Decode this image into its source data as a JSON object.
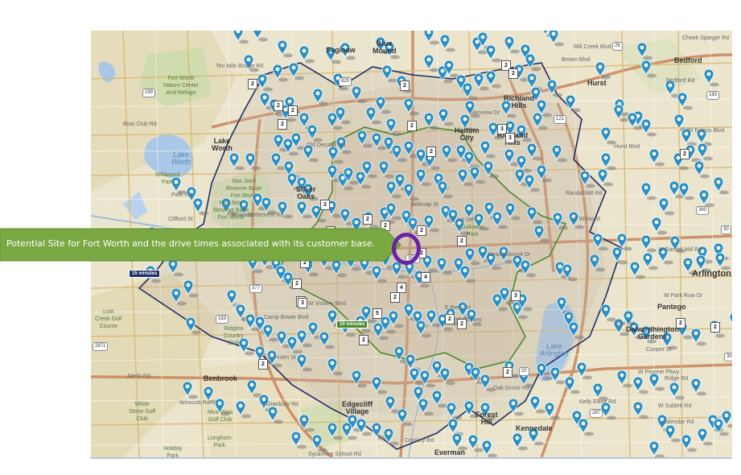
{
  "callout": {
    "text": "Potential Site for Fort Worth and the drive times associated with its customer base."
  },
  "colors": {
    "callout_fill": "#7aa843",
    "site_marker": "#6a22a7",
    "customer_pin": "#2a8fc4",
    "drive_time_15": "#1d2f66",
    "drive_time_10": "#4c8a2f"
  },
  "drive_times": {
    "outer_label": "15 minutes",
    "inner_label": "10 minutes"
  },
  "map": {
    "places": [
      {
        "name": "Saginaw",
        "cls": "city"
      },
      {
        "name": "Blue\nMound",
        "cls": "city"
      },
      {
        "name": "Fort Worth\nNature Center\nAnd Refuge",
        "cls": "green"
      },
      {
        "name": "Lake\nWorth",
        "cls": "city"
      },
      {
        "name": "Lake\nWorth",
        "cls": "water"
      },
      {
        "name": "Haltom\nCity",
        "cls": "city"
      },
      {
        "name": "Richland\nHills",
        "cls": "city"
      },
      {
        "name": "Richland\nHills",
        "cls": "city"
      },
      {
        "name": "Hurst",
        "cls": "city"
      },
      {
        "name": "Bedford",
        "cls": "city"
      },
      {
        "name": "Arlington",
        "cls": "big"
      },
      {
        "name": "Pantego",
        "cls": "city"
      },
      {
        "name": "Dalworthington\nGardens",
        "cls": "city"
      },
      {
        "name": "Lake\nArlington",
        "cls": "water"
      },
      {
        "name": "Benbrook",
        "cls": "city"
      },
      {
        "name": "Edgecliff\nVillage",
        "cls": "city"
      },
      {
        "name": "Forest\nHill",
        "cls": "city"
      },
      {
        "name": "Kennedale",
        "cls": "city"
      },
      {
        "name": "Everman",
        "cls": "city"
      },
      {
        "name": "Nas Joint\nReserve Base\nFort Worth",
        "cls": "green"
      },
      {
        "name": "Nas Joint\nReserve Base\nFort Worth",
        "cls": "green"
      },
      {
        "name": "Silver\nOaks",
        "cls": "city"
      },
      {
        "name": "Lost\nCreek Golf\nCourse",
        "cls": "green"
      },
      {
        "name": "Ridglea\nCountry\nClub",
        "cls": "green"
      },
      {
        "name": "Mira Vista\nGolf Club",
        "cls": "green"
      },
      {
        "name": "White\nStone Golf\nClub",
        "cls": "green"
      },
      {
        "name": "Longhorn\nPark",
        "cls": "green"
      },
      {
        "name": "Holiday\nPark",
        "cls": "green"
      },
      {
        "name": "Wildwood\nPark",
        "cls": "green"
      },
      {
        "name": "Galloway\nPark",
        "cls": "green"
      },
      {
        "name": "Meadowbrook Dr",
        "cls": "road"
      },
      {
        "name": "E 1st St",
        "cls": "road"
      },
      {
        "name": "Belknap St",
        "cls": "road"
      },
      {
        "name": "E Berry St",
        "cls": "road"
      },
      {
        "name": "W Randol Mill Rd",
        "cls": "road"
      },
      {
        "name": "W Park Row Dr",
        "cls": "road"
      },
      {
        "name": "Aledo Rd",
        "cls": "road"
      },
      {
        "name": "Winscott Rd",
        "cls": "road"
      },
      {
        "name": "Old Decatur Rd",
        "cls": "road"
      },
      {
        "name": "Glenview Dr",
        "cls": "road"
      },
      {
        "name": "Hurst Blvd",
        "cls": "road"
      },
      {
        "name": "Randol Mill Rd",
        "cls": "road"
      },
      {
        "name": "W Pioneer Pkwy",
        "cls": "road"
      },
      {
        "name": "W Sublett Rd",
        "cls": "road"
      },
      {
        "name": "Mansfield Hwy",
        "cls": "road"
      },
      {
        "name": "Oak Grove Rd",
        "cls": "road"
      },
      {
        "name": "Ten Mile Bridge Rd",
        "cls": "road"
      },
      {
        "name": "Boat Club Rd",
        "cls": "road"
      },
      {
        "name": "Park Rd",
        "cls": "road"
      },
      {
        "name": "White Settlement Rd",
        "cls": "road"
      },
      {
        "name": "Clifford St",
        "cls": "road"
      },
      {
        "name": "W Vickery Blvd",
        "cls": "road"
      },
      {
        "name": "Camp Bowie Blvd",
        "cls": "road"
      },
      {
        "name": "Hulen St",
        "cls": "road"
      },
      {
        "name": "Granbury Rd",
        "cls": "road"
      },
      {
        "name": "Crowley Rd",
        "cls": "road"
      },
      {
        "name": "Sycamore School Rd",
        "cls": "road"
      },
      {
        "name": "E White St",
        "cls": "road"
      },
      {
        "name": "Brown Blvd",
        "cls": "road"
      },
      {
        "name": "Bedford Rd",
        "cls": "road"
      },
      {
        "name": "Cheek Sparger Rd",
        "cls": "road"
      },
      {
        "name": "Mill Creek Blvd",
        "cls": "road"
      },
      {
        "name": "W Euless Blvd",
        "cls": "road"
      },
      {
        "name": "Little Rd",
        "cls": "road"
      },
      {
        "name": "Cooper St",
        "cls": "road"
      },
      {
        "name": "Ridge Rd",
        "cls": "road"
      },
      {
        "name": "Kelly Elliott Rd",
        "cls": "road"
      },
      {
        "name": "Calendar Rd",
        "cls": "road"
      }
    ],
    "badges": [
      "2",
      "2",
      "2",
      "2",
      "2",
      "2",
      "2",
      "2",
      "2",
      "2",
      "2",
      "2",
      "2",
      "2",
      "2",
      "2",
      "2",
      "2",
      "2",
      "2",
      "2",
      "2",
      "2",
      "2",
      "2",
      "2",
      "2",
      "3",
      "3",
      "3",
      "3",
      "3",
      "4",
      "4",
      "5"
    ],
    "shields": [
      "199",
      "820",
      "183",
      "377",
      "35W",
      "20",
      "30",
      "287",
      "121",
      "183",
      "26",
      "360",
      "2871",
      "303"
    ]
  }
}
